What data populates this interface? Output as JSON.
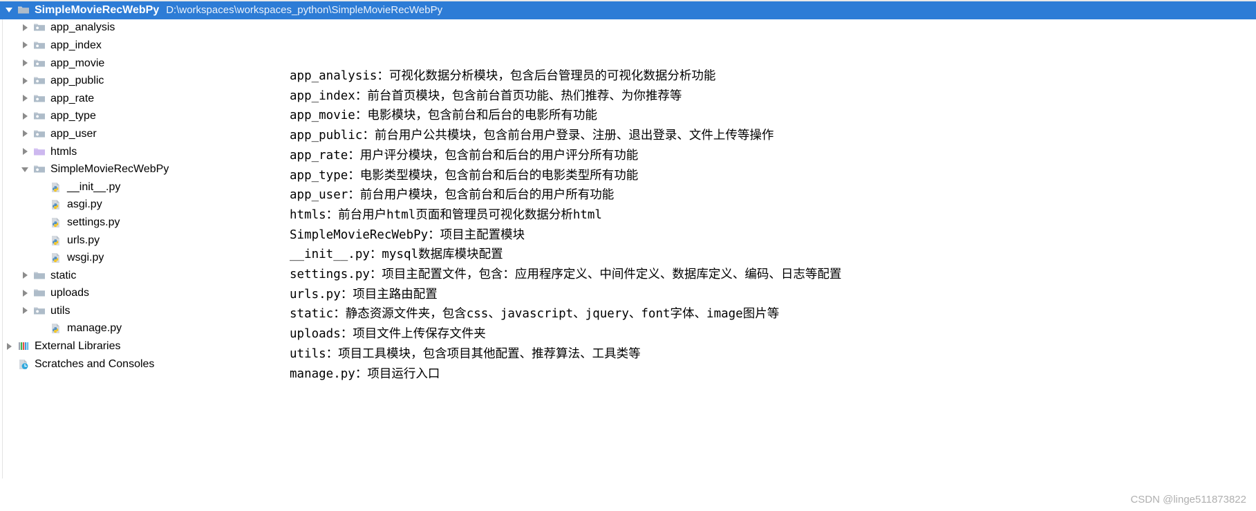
{
  "header": {
    "project_name": "SimpleMovieRecWebPy",
    "project_path": "D:\\workspaces\\workspaces_python\\SimpleMovieRecWebPy",
    "selected_color": "#2d7cd6"
  },
  "tree": {
    "items": [
      {
        "label": "app_analysis",
        "icon": "python-package-folder-icon",
        "arrow": "right",
        "level": 1
      },
      {
        "label": "app_index",
        "icon": "python-package-folder-icon",
        "arrow": "right",
        "level": 1
      },
      {
        "label": "app_movie",
        "icon": "python-package-folder-icon",
        "arrow": "right",
        "level": 1
      },
      {
        "label": "app_public",
        "icon": "python-package-folder-icon",
        "arrow": "right",
        "level": 1
      },
      {
        "label": "app_rate",
        "icon": "python-package-folder-icon",
        "arrow": "right",
        "level": 1
      },
      {
        "label": "app_type",
        "icon": "python-package-folder-icon",
        "arrow": "right",
        "level": 1
      },
      {
        "label": "app_user",
        "icon": "python-package-folder-icon",
        "arrow": "right",
        "level": 1
      },
      {
        "label": "htmls",
        "icon": "template-folder-icon",
        "arrow": "right",
        "level": 1
      },
      {
        "label": "SimpleMovieRecWebPy",
        "icon": "python-package-folder-icon",
        "arrow": "down",
        "level": 1
      },
      {
        "label": "__init__.py",
        "icon": "python-file-icon",
        "arrow": "none",
        "level": 2
      },
      {
        "label": "asgi.py",
        "icon": "python-file-icon",
        "arrow": "none",
        "level": 2
      },
      {
        "label": "settings.py",
        "icon": "python-file-icon",
        "arrow": "none",
        "level": 2
      },
      {
        "label": "urls.py",
        "icon": "python-file-icon",
        "arrow": "none",
        "level": 2
      },
      {
        "label": "wsgi.py",
        "icon": "python-file-icon",
        "arrow": "none",
        "level": 2
      },
      {
        "label": "static",
        "icon": "folder-icon",
        "arrow": "right",
        "level": 1
      },
      {
        "label": "uploads",
        "icon": "folder-icon",
        "arrow": "right",
        "level": 1
      },
      {
        "label": "utils",
        "icon": "python-package-folder-icon",
        "arrow": "right",
        "level": 1
      },
      {
        "label": "manage.py",
        "icon": "python-file-icon",
        "arrow": "none",
        "level": 2
      },
      {
        "label": "External Libraries",
        "icon": "external-libraries-icon",
        "arrow": "right",
        "level": 0
      },
      {
        "label": "Scratches and Consoles",
        "icon": "scratches-icon",
        "arrow": "none",
        "level": 0
      }
    ]
  },
  "description": {
    "lines": [
      "app_analysis：可视化数据分析模块，包含后台管理员的可视化数据分析功能",
      "app_index：前台首页模块，包含前台首页功能、热们推荐、为你推荐等",
      "app_movie：电影模块，包含前台和后台的电影所有功能",
      "app_public：前台用户公共模块，包含前台用户登录、注册、退出登录、文件上传等操作",
      "app_rate：用户评分模块，包含前台和后台的用户评分所有功能",
      "app_type：电影类型模块，包含前台和后台的电影类型所有功能",
      "app_user：前台用户模块，包含前台和后台的用户所有功能",
      "htmls：前台用户html页面和管理员可视化数据分析html",
      "SimpleMovieRecWebPy：项目主配置模块",
      "__init__.py：mysql数据库模块配置",
      "settings.py：项目主配置文件，包含：应用程序定义、中间件定义、数据库定义、编码、日志等配置",
      "urls.py：项目主路由配置",
      "static：静态资源文件夹，包含css、javascript、jquery、font字体、image图片等",
      "uploads：项目文件上传保存文件夹",
      "utils：项目工具模块，包含项目其他配置、推荐算法、工具类等",
      "manage.py：项目运行入口"
    ]
  },
  "watermark": {
    "text": "CSDN @linge511873822"
  }
}
